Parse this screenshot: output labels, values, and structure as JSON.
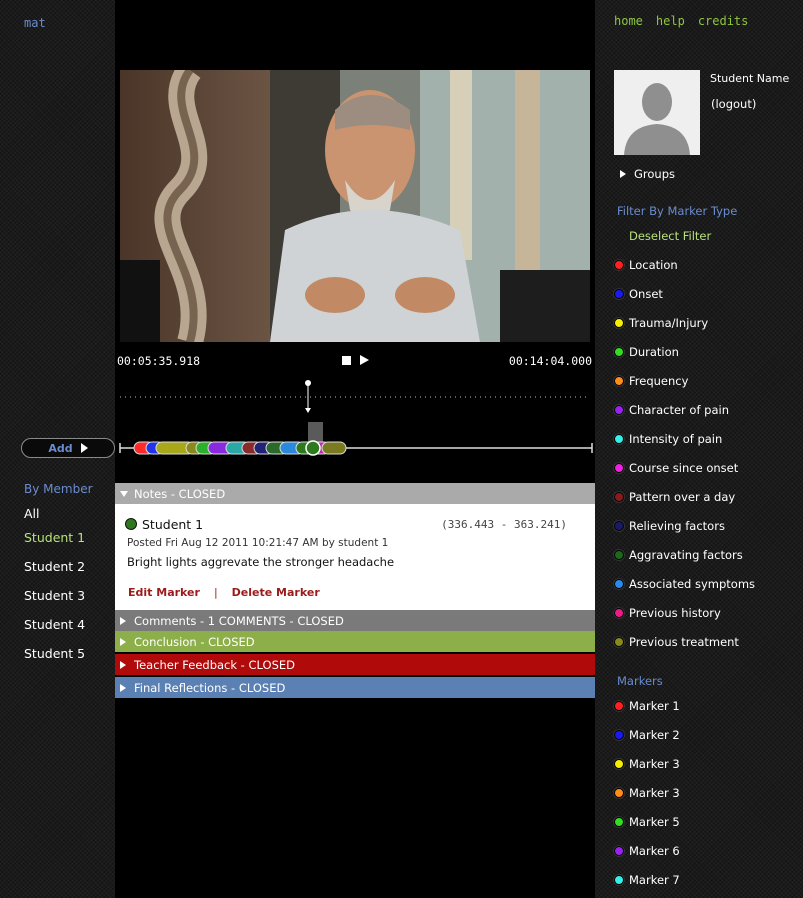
{
  "left": {
    "logo": "mat",
    "add_label": "Add",
    "by_member_heading": "By Member",
    "members": [
      {
        "label": "All",
        "selected": false
      },
      {
        "label": "Student 1",
        "selected": true
      },
      {
        "label": "Student 2",
        "selected": false
      },
      {
        "label": "Student 3",
        "selected": false
      },
      {
        "label": "Student 4",
        "selected": false
      },
      {
        "label": "Student 5",
        "selected": false
      }
    ]
  },
  "player": {
    "current_time": "00:05:35.918",
    "total_time": "00:14:04.000",
    "timeline_markers": [
      "#ff2a2a",
      "#2233ee",
      "#a8a81a",
      "#8a8a1a",
      "#2ab02a",
      "#8a2ae0",
      "#2aa8a8",
      "#8a2a2a",
      "#222277",
      "#2a6a2a",
      "#2a88dd",
      "#2d7a1e",
      "#c02ab0",
      "#7a7a20"
    ]
  },
  "panels": {
    "notes": {
      "label": "Notes - CLOSED",
      "color": "#aaaaaa",
      "student": "Student 1",
      "range": "(336.443 - 363.241)",
      "posted": "Posted Fri Aug 12 2011 10:21:47 AM by student 1",
      "text": "Bright lights aggrevate the stronger headache",
      "edit_label": "Edit Marker",
      "separator": "|",
      "delete_label": "Delete Marker"
    },
    "comments": {
      "label": "Comments - 1 COMMENTS - CLOSED",
      "color": "#7a7a7a"
    },
    "conclusion": {
      "label": "Conclusion - CLOSED",
      "color": "#8daf4a"
    },
    "teacher_feedback": {
      "label": "Teacher Feedback - CLOSED",
      "color": "#b00a0a"
    },
    "final_reflections": {
      "label": "Final Reflections  - CLOSED",
      "color": "#5a80b4"
    }
  },
  "right": {
    "nav": [
      "home",
      "help",
      "credits"
    ],
    "student_name": "Student Name",
    "logout": "(logout)",
    "groups": "Groups",
    "filter_heading": "Filter By Marker Type",
    "deselect": "Deselect Filter",
    "filters": [
      {
        "label": "Location",
        "color": "#ff2020"
      },
      {
        "label": "Onset",
        "color": "#1a1aee"
      },
      {
        "label": "Trauma/Injury",
        "color": "#f5f000"
      },
      {
        "label": "Duration",
        "color": "#33dd22"
      },
      {
        "label": "Frequency",
        "color": "#ff8c1a"
      },
      {
        "label": "Character of pain",
        "color": "#9a22ee"
      },
      {
        "label": "Intensity of pain",
        "color": "#33f0e8"
      },
      {
        "label": "Course since onset",
        "color": "#ee22dd"
      },
      {
        "label": "Pattern over a day",
        "color": "#8b1a1a"
      },
      {
        "label": "Relieving factors",
        "color": "#1a1a6a"
      },
      {
        "label": "Aggravating factors",
        "color": "#1a6a1a"
      },
      {
        "label": "Associated symptoms",
        "color": "#2a8ae8"
      },
      {
        "label": "Previous history",
        "color": "#ee1a8a"
      },
      {
        "label": "Previous treatment",
        "color": "#8a8a1a"
      }
    ],
    "markers_heading": "Markers",
    "markers": [
      {
        "label": "Marker 1",
        "color": "#ff2020"
      },
      {
        "label": "Marker 2",
        "color": "#1a1aee"
      },
      {
        "label": "Marker 3",
        "color": "#f5f000"
      },
      {
        "label": "Marker 3",
        "color": "#ff8c1a"
      },
      {
        "label": "Marker 5",
        "color": "#33dd22"
      },
      {
        "label": "Marker 6",
        "color": "#9a22ee"
      },
      {
        "label": "Marker 7",
        "color": "#33f0e8"
      }
    ]
  }
}
